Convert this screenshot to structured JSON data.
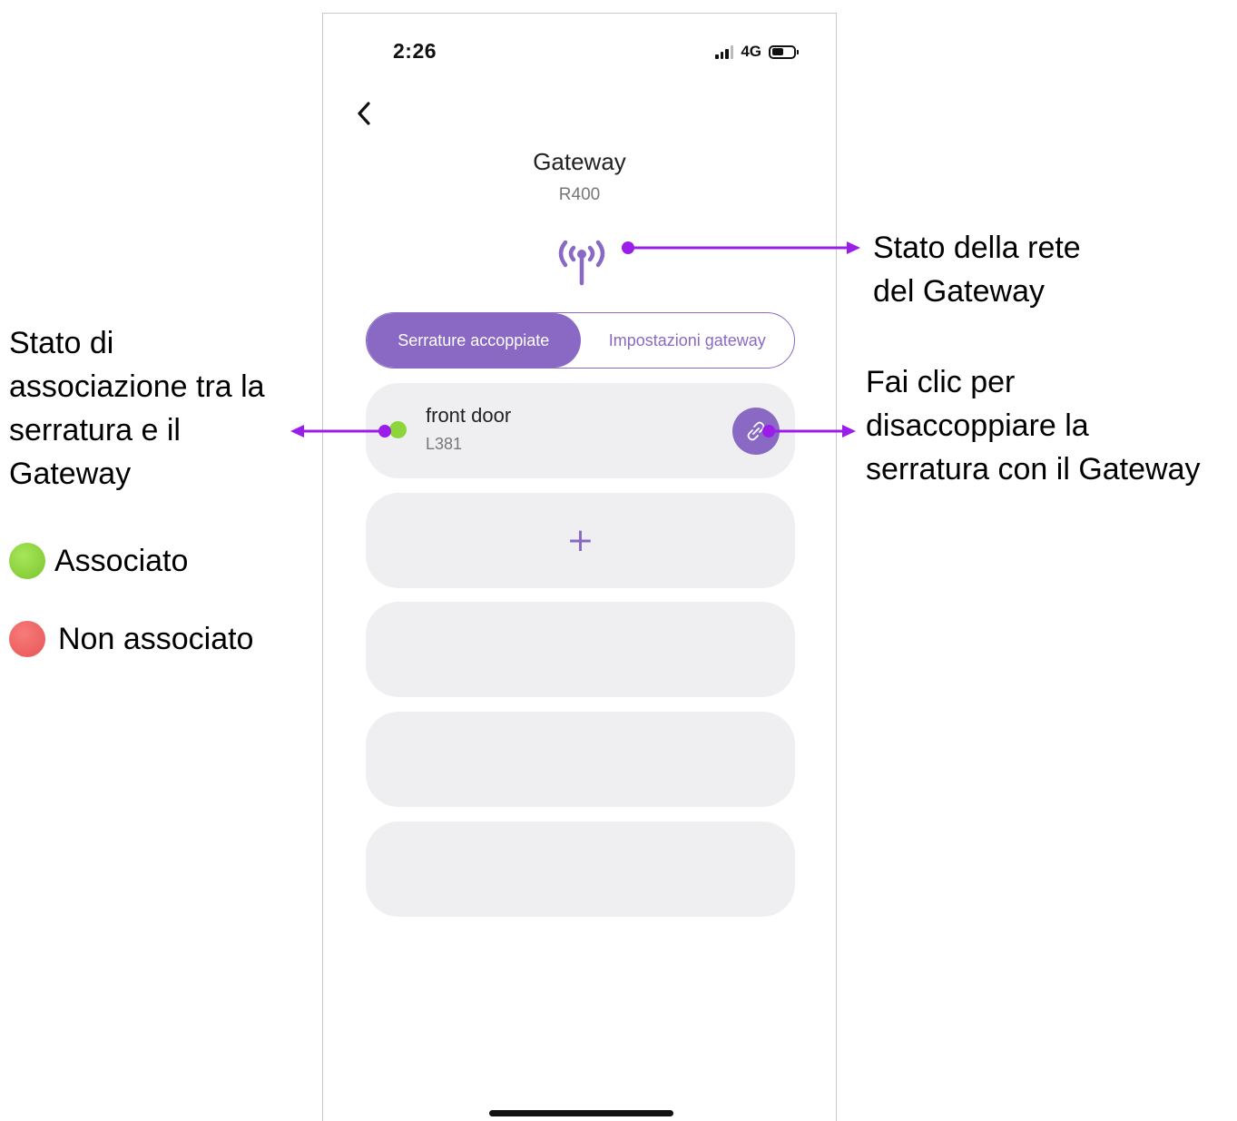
{
  "colors": {
    "accent": "#8a69c4",
    "annotation_arrow": "#9b1dea",
    "associated": "#8cd53b",
    "not_associated": "#ef5f5f",
    "card_bg": "#efeff2"
  },
  "status_bar": {
    "time": "2:26",
    "network": "4G",
    "signal_icon": "cellular-signal-icon",
    "battery_icon": "battery-icon"
  },
  "header": {
    "back_icon": "chevron-left-icon",
    "title": "Gateway",
    "subtitle": "R400",
    "network_status_icon": "antenna-signal-icon"
  },
  "tabs": [
    {
      "label": "Serrature accoppiate",
      "active": true
    },
    {
      "label": "Impostazioni gateway",
      "active": false
    }
  ],
  "locks": [
    {
      "name": "front door",
      "model": "L381",
      "status": "associated",
      "action_icon": "unlink-icon"
    }
  ],
  "add_button": {
    "label": "+"
  },
  "annotations": {
    "network_status": [
      "Stato della rete",
      "del Gateway"
    ],
    "unlink": [
      "Fai clic per",
      "disaccoppiare la",
      "serratura con il Gateway"
    ],
    "association": [
      "Stato di",
      "associazione tra la",
      "serratura e il",
      "Gateway"
    ]
  },
  "legend": {
    "associated": "Associato",
    "not_associated": "Non associato"
  }
}
